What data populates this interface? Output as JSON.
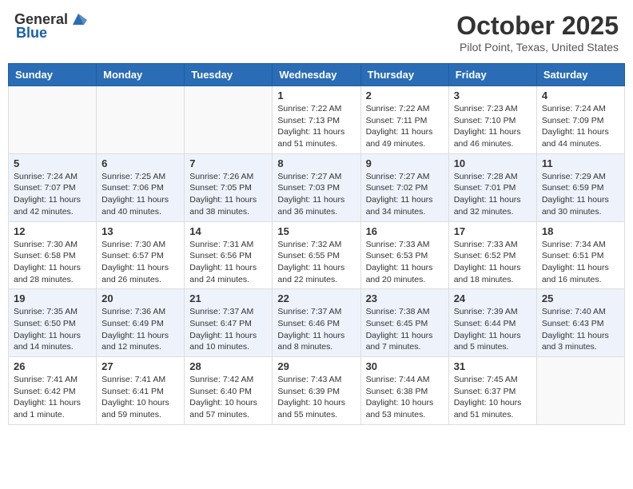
{
  "header": {
    "logo_general": "General",
    "logo_blue": "Blue",
    "month": "October 2025",
    "location": "Pilot Point, Texas, United States"
  },
  "days_of_week": [
    "Sunday",
    "Monday",
    "Tuesday",
    "Wednesday",
    "Thursday",
    "Friday",
    "Saturday"
  ],
  "weeks": [
    [
      {
        "day": "",
        "info": ""
      },
      {
        "day": "",
        "info": ""
      },
      {
        "day": "",
        "info": ""
      },
      {
        "day": "1",
        "info": "Sunrise: 7:22 AM\nSunset: 7:13 PM\nDaylight: 11 hours and 51 minutes."
      },
      {
        "day": "2",
        "info": "Sunrise: 7:22 AM\nSunset: 7:11 PM\nDaylight: 11 hours and 49 minutes."
      },
      {
        "day": "3",
        "info": "Sunrise: 7:23 AM\nSunset: 7:10 PM\nDaylight: 11 hours and 46 minutes."
      },
      {
        "day": "4",
        "info": "Sunrise: 7:24 AM\nSunset: 7:09 PM\nDaylight: 11 hours and 44 minutes."
      }
    ],
    [
      {
        "day": "5",
        "info": "Sunrise: 7:24 AM\nSunset: 7:07 PM\nDaylight: 11 hours and 42 minutes."
      },
      {
        "day": "6",
        "info": "Sunrise: 7:25 AM\nSunset: 7:06 PM\nDaylight: 11 hours and 40 minutes."
      },
      {
        "day": "7",
        "info": "Sunrise: 7:26 AM\nSunset: 7:05 PM\nDaylight: 11 hours and 38 minutes."
      },
      {
        "day": "8",
        "info": "Sunrise: 7:27 AM\nSunset: 7:03 PM\nDaylight: 11 hours and 36 minutes."
      },
      {
        "day": "9",
        "info": "Sunrise: 7:27 AM\nSunset: 7:02 PM\nDaylight: 11 hours and 34 minutes."
      },
      {
        "day": "10",
        "info": "Sunrise: 7:28 AM\nSunset: 7:01 PM\nDaylight: 11 hours and 32 minutes."
      },
      {
        "day": "11",
        "info": "Sunrise: 7:29 AM\nSunset: 6:59 PM\nDaylight: 11 hours and 30 minutes."
      }
    ],
    [
      {
        "day": "12",
        "info": "Sunrise: 7:30 AM\nSunset: 6:58 PM\nDaylight: 11 hours and 28 minutes."
      },
      {
        "day": "13",
        "info": "Sunrise: 7:30 AM\nSunset: 6:57 PM\nDaylight: 11 hours and 26 minutes."
      },
      {
        "day": "14",
        "info": "Sunrise: 7:31 AM\nSunset: 6:56 PM\nDaylight: 11 hours and 24 minutes."
      },
      {
        "day": "15",
        "info": "Sunrise: 7:32 AM\nSunset: 6:55 PM\nDaylight: 11 hours and 22 minutes."
      },
      {
        "day": "16",
        "info": "Sunrise: 7:33 AM\nSunset: 6:53 PM\nDaylight: 11 hours and 20 minutes."
      },
      {
        "day": "17",
        "info": "Sunrise: 7:33 AM\nSunset: 6:52 PM\nDaylight: 11 hours and 18 minutes."
      },
      {
        "day": "18",
        "info": "Sunrise: 7:34 AM\nSunset: 6:51 PM\nDaylight: 11 hours and 16 minutes."
      }
    ],
    [
      {
        "day": "19",
        "info": "Sunrise: 7:35 AM\nSunset: 6:50 PM\nDaylight: 11 hours and 14 minutes."
      },
      {
        "day": "20",
        "info": "Sunrise: 7:36 AM\nSunset: 6:49 PM\nDaylight: 11 hours and 12 minutes."
      },
      {
        "day": "21",
        "info": "Sunrise: 7:37 AM\nSunset: 6:47 PM\nDaylight: 11 hours and 10 minutes."
      },
      {
        "day": "22",
        "info": "Sunrise: 7:37 AM\nSunset: 6:46 PM\nDaylight: 11 hours and 8 minutes."
      },
      {
        "day": "23",
        "info": "Sunrise: 7:38 AM\nSunset: 6:45 PM\nDaylight: 11 hours and 7 minutes."
      },
      {
        "day": "24",
        "info": "Sunrise: 7:39 AM\nSunset: 6:44 PM\nDaylight: 11 hours and 5 minutes."
      },
      {
        "day": "25",
        "info": "Sunrise: 7:40 AM\nSunset: 6:43 PM\nDaylight: 11 hours and 3 minutes."
      }
    ],
    [
      {
        "day": "26",
        "info": "Sunrise: 7:41 AM\nSunset: 6:42 PM\nDaylight: 11 hours and 1 minute."
      },
      {
        "day": "27",
        "info": "Sunrise: 7:41 AM\nSunset: 6:41 PM\nDaylight: 10 hours and 59 minutes."
      },
      {
        "day": "28",
        "info": "Sunrise: 7:42 AM\nSunset: 6:40 PM\nDaylight: 10 hours and 57 minutes."
      },
      {
        "day": "29",
        "info": "Sunrise: 7:43 AM\nSunset: 6:39 PM\nDaylight: 10 hours and 55 minutes."
      },
      {
        "day": "30",
        "info": "Sunrise: 7:44 AM\nSunset: 6:38 PM\nDaylight: 10 hours and 53 minutes."
      },
      {
        "day": "31",
        "info": "Sunrise: 7:45 AM\nSunset: 6:37 PM\nDaylight: 10 hours and 51 minutes."
      },
      {
        "day": "",
        "info": ""
      }
    ]
  ]
}
